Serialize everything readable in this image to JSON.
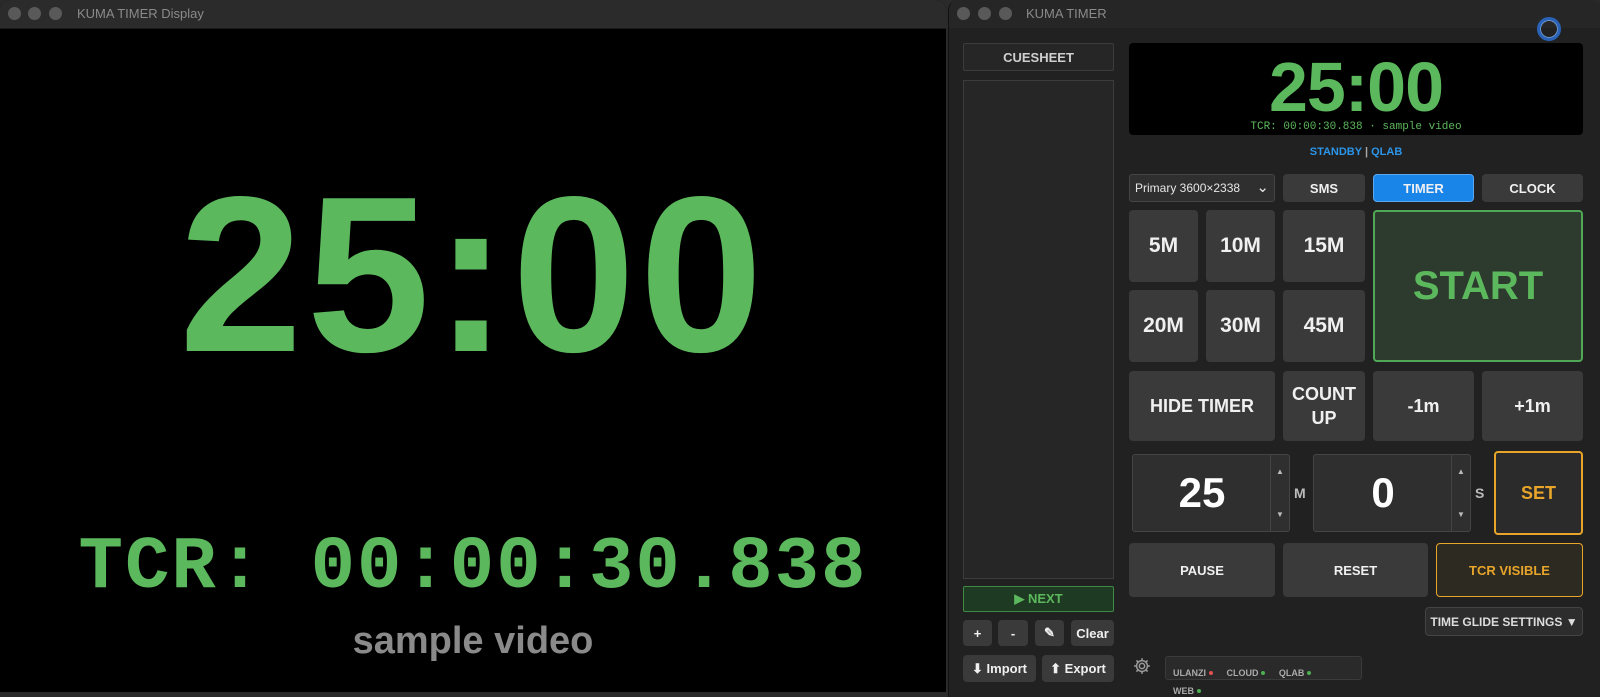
{
  "display_window": {
    "title": "KUMA TIMER Display",
    "timer": "25:00",
    "tcr": "TCR: 00:00:30.838",
    "label": "sample video"
  },
  "control_window": {
    "title": "KUMA TIMER",
    "cuesheet": {
      "header": "CUESHEET",
      "next_label": "▶ NEXT"
    },
    "cue_tools": {
      "add": "+",
      "remove": "-",
      "edit": "✎",
      "clear": "Clear",
      "import": "⬇ Import",
      "export": "⬆ Export"
    },
    "preview": {
      "time": "25:00",
      "tcr": "TCR: 00:00:30.838 · sample video"
    },
    "status": {
      "standby": "STANDBY",
      "separator": "|",
      "qlab": "QLAB"
    },
    "display_select": {
      "value": "Primary  3600×2338"
    },
    "modes": {
      "sms": "SMS",
      "timer": "TIMER",
      "clock": "CLOCK",
      "active": "TIMER"
    },
    "presets": [
      "5M",
      "10M",
      "15M",
      "20M",
      "30M",
      "45M"
    ],
    "start_label": "START",
    "hide_timer": "HIDE TIMER",
    "count_up": "COUNT UP",
    "minus_1m": "-1m",
    "plus_1m": "+1m",
    "minutes": {
      "value": "25",
      "unit": "M"
    },
    "seconds": {
      "value": "0",
      "unit": "S"
    },
    "set_label": "SET",
    "pause": "PAUSE",
    "reset": "RESET",
    "tcr_visible": "TCR VISIBLE",
    "time_glide": "TIME GLIDE SETTINGS ▼",
    "connections": [
      {
        "label": "ULANZI",
        "color": "#e05050"
      },
      {
        "label": "CLOUD",
        "color": "#4caf50"
      },
      {
        "label": "QLAB",
        "color": "#4caf50"
      },
      {
        "label": "WEB",
        "color": "#4caf50"
      }
    ],
    "colors": {
      "accent_green": "#5cb85c",
      "accent_blue": "#1a85e8",
      "accent_orange": "#e8a52a"
    }
  }
}
